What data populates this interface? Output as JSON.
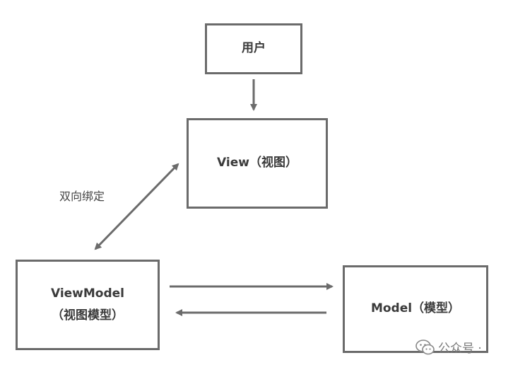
{
  "nodes": {
    "user": {
      "label": "用户"
    },
    "view": {
      "label": "View（视图）"
    },
    "viewmodel": {
      "label_line1": "ViewModel",
      "label_line2": "（视图模型）"
    },
    "model": {
      "label": "Model（模型）"
    }
  },
  "edges": {
    "user_to_view": {
      "direction": "down"
    },
    "binding": {
      "label": "双向绑定",
      "direction": "bidirectional"
    },
    "viewmodel_to_model": {
      "direction": "right"
    },
    "model_to_viewmodel": {
      "direction": "left"
    }
  },
  "watermark": {
    "icon": "wechat-icon",
    "text": "公众号 ·"
  },
  "colors": {
    "stroke": "#6b6b6b",
    "text": "#3a3a3a"
  }
}
